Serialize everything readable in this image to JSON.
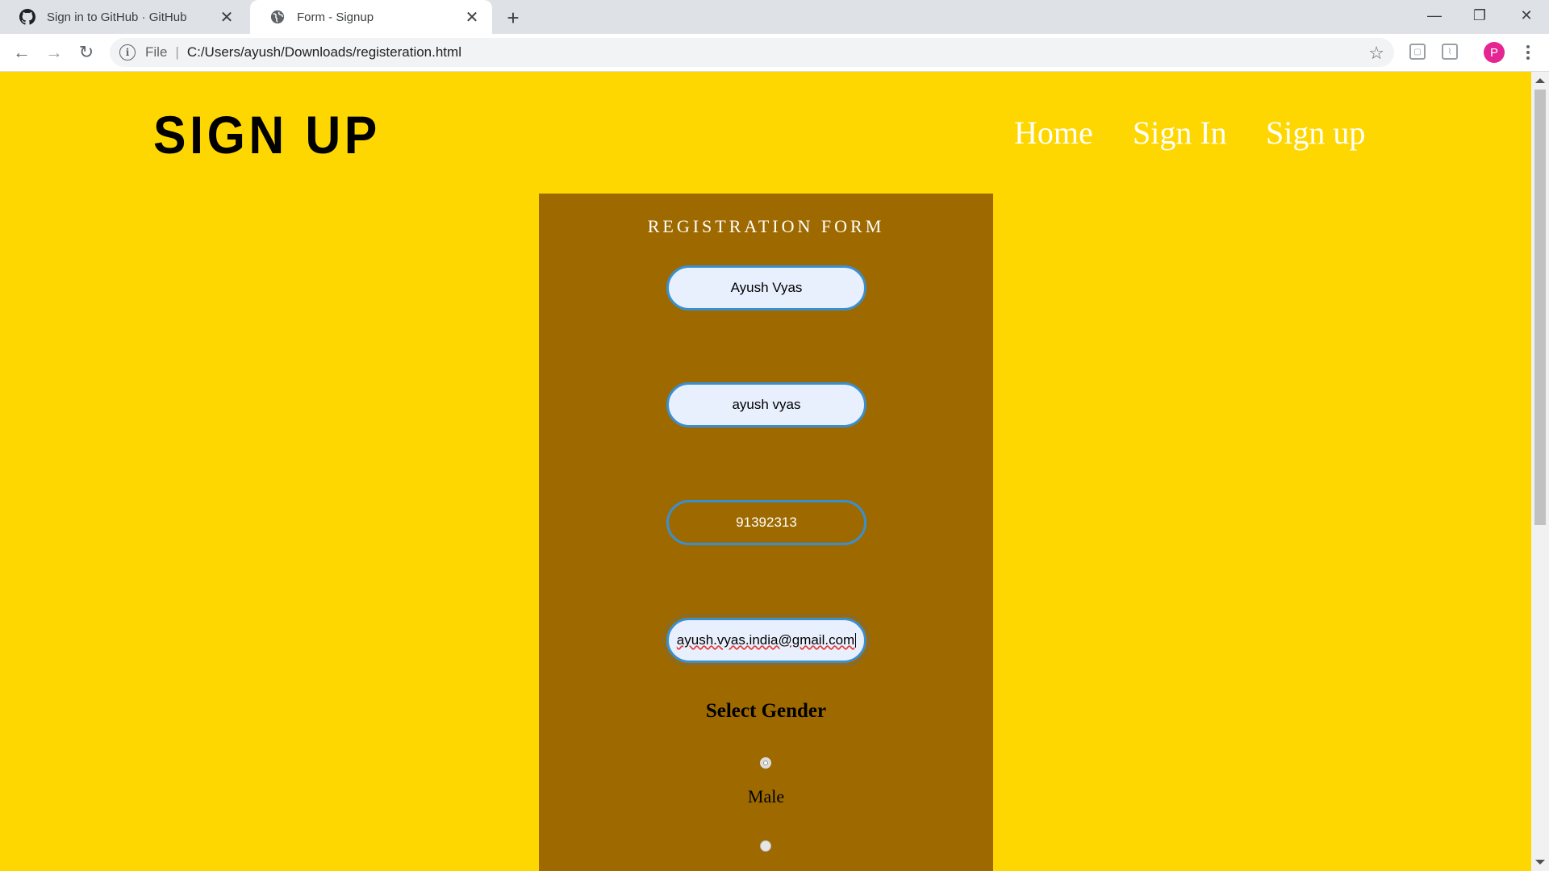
{
  "browser": {
    "tabs": [
      {
        "title": "Sign in to GitHub · GitHub",
        "icon": "github-icon"
      },
      {
        "title": "Form - Signup",
        "icon": "globe-icon"
      }
    ],
    "url_scheme_label": "File",
    "url": "C:/Users/ayush/Downloads/registeration.html",
    "profile_initial": "P"
  },
  "page": {
    "brand": "SIGN UP",
    "nav": [
      "Home",
      "Sign In",
      "Sign up"
    ],
    "background_color": "#ffd700",
    "form_color": "#9e6a00",
    "form": {
      "title": "REGISTRATION FORM",
      "fields": {
        "name": "Ayush Vyas",
        "username": "ayush vyas",
        "phone": "91392313",
        "email": "ayush.vyas.india@gmail.com"
      },
      "gender_title": "Select Gender",
      "gender_options": [
        "Male"
      ]
    }
  }
}
